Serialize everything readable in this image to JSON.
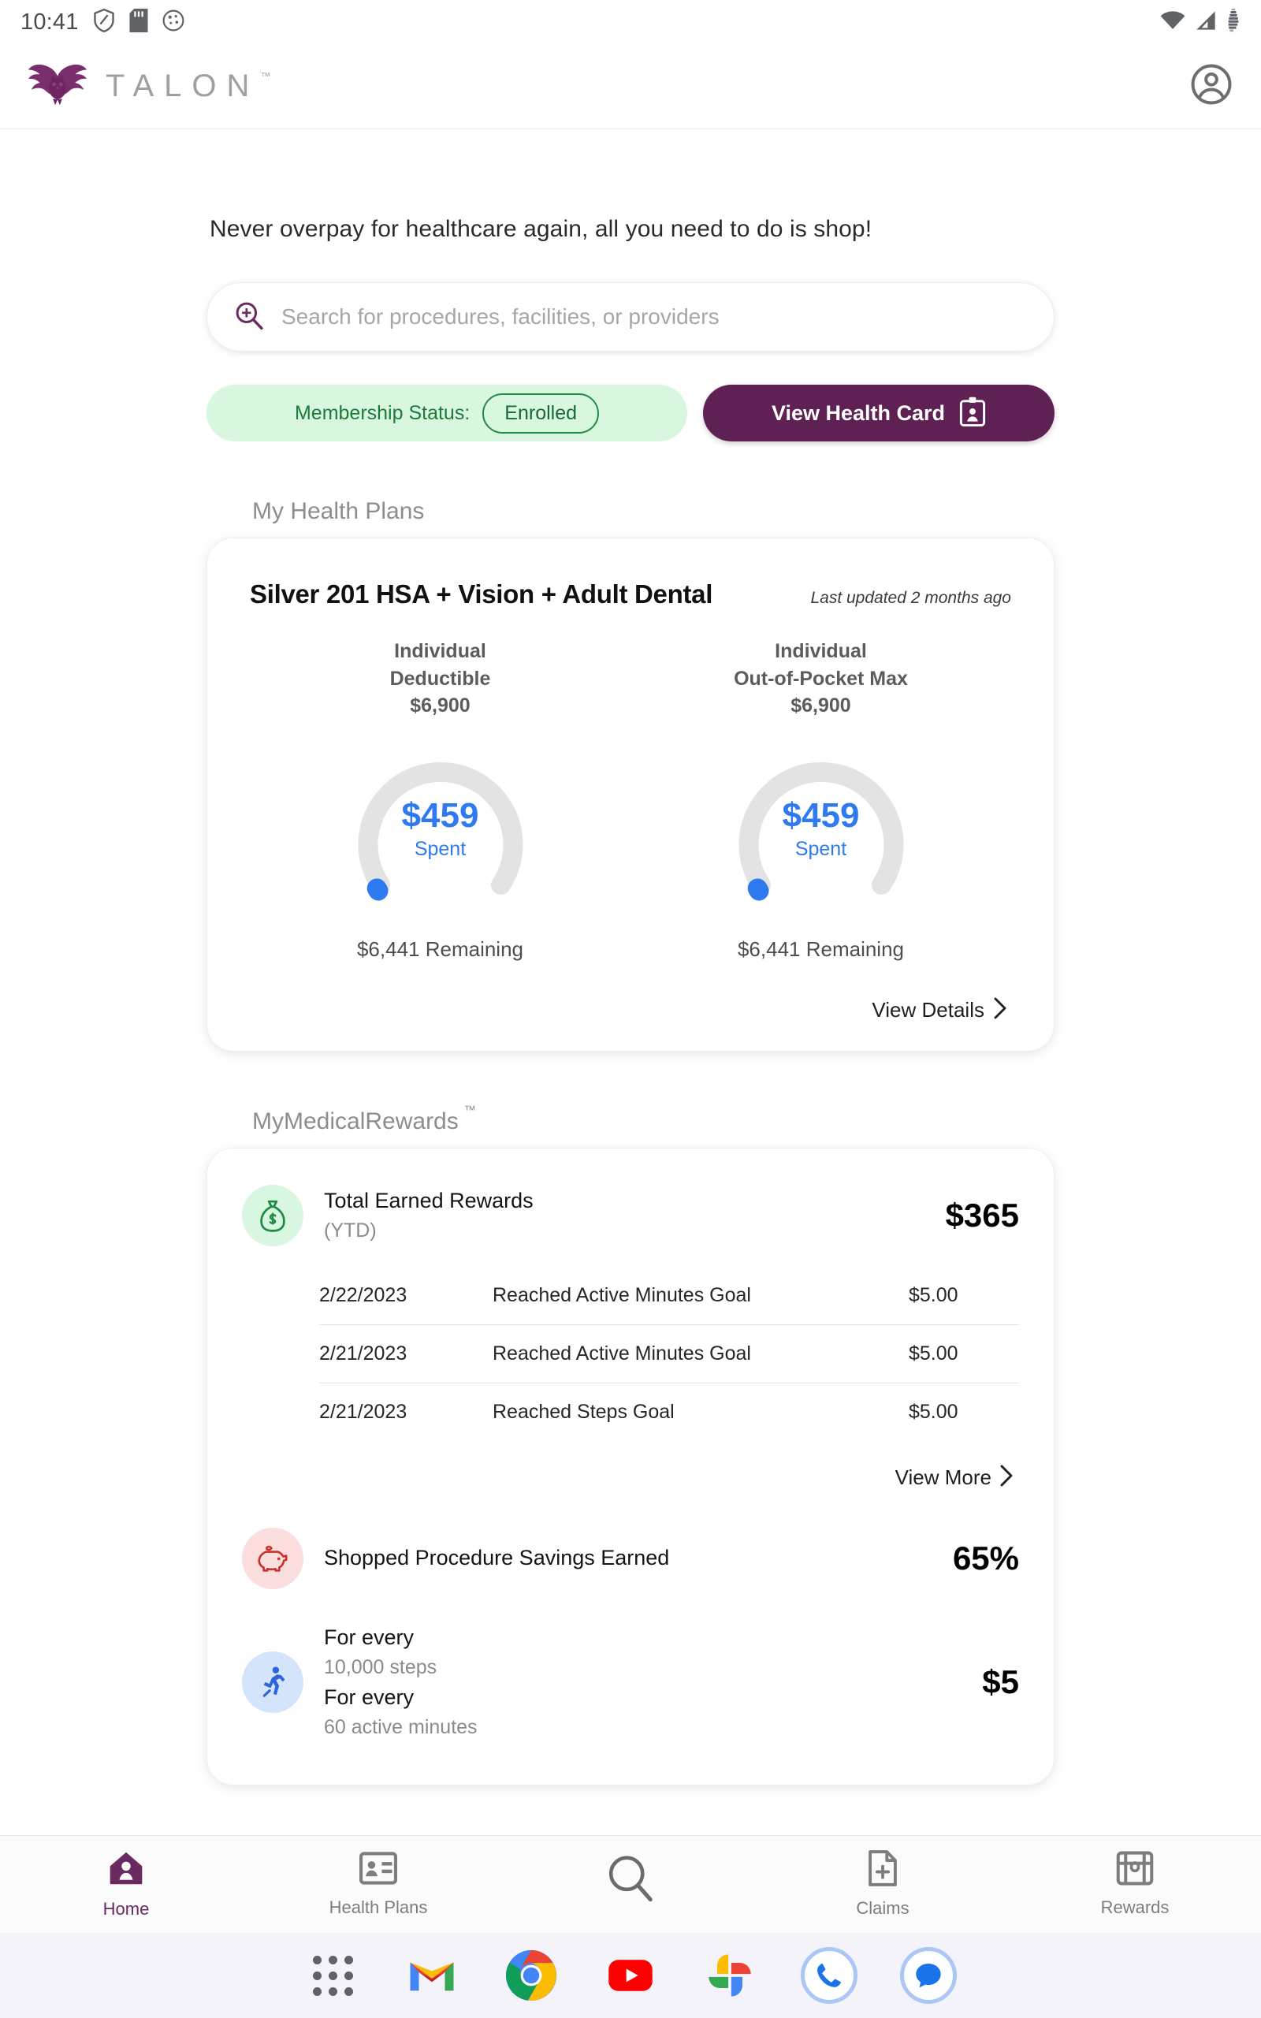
{
  "status_bar": {
    "time": "10:41",
    "left_icons": [
      "shield-icon",
      "sd-card-icon",
      "cookie-icon"
    ],
    "right_icons": [
      "wifi-icon",
      "cellular-signal-icon",
      "battery-bars-icon"
    ]
  },
  "app_header": {
    "brand": "TALON",
    "brand_tm": "™",
    "account_icon": "account-circle-icon"
  },
  "hero": {
    "tagline": "Never overpay for healthcare again, all you need to do is shop!"
  },
  "search": {
    "placeholder": "Search for procedures, facilities, or providers",
    "icon": "zoom-in-search-icon"
  },
  "membership": {
    "label": "Membership Status:",
    "status": "Enrolled",
    "health_card_button": "View Health Card",
    "health_card_icon": "id-badge-icon"
  },
  "health_plans": {
    "section_label": "My Health Plans",
    "plan_name": "Silver 201 HSA + Vision + Adult Dental",
    "last_updated": "Last updated 2 months ago",
    "view_details": "View Details",
    "gauges": [
      {
        "title_line1": "Individual",
        "title_line2": "Deductible",
        "limit": "$6,900",
        "spent_amount": "$459",
        "spent_label": "Spent",
        "remaining": "$6,441 Remaining",
        "percent": 6.7
      },
      {
        "title_line1": "Individual",
        "title_line2": "Out-of-Pocket Max",
        "limit": "$6,900",
        "spent_amount": "$459",
        "spent_label": "Spent",
        "remaining": "$6,441 Remaining",
        "percent": 6.7
      }
    ]
  },
  "rewards": {
    "section_label": "MyMedicalRewards",
    "section_tm": "™",
    "total": {
      "icon": "money-bag-icon",
      "title": "Total Earned Rewards",
      "subtitle": "(YTD)",
      "value": "$365"
    },
    "table_rows": [
      {
        "date": "2/22/2023",
        "description": "Reached Active Minutes Goal",
        "amount": "$5.00"
      },
      {
        "date": "2/21/2023",
        "description": "Reached Active Minutes Goal",
        "amount": "$5.00"
      },
      {
        "date": "2/21/2023",
        "description": "Reached Steps Goal",
        "amount": "$5.00"
      }
    ],
    "view_more": "View More",
    "savings": {
      "icon": "piggy-bank-icon",
      "title": "Shopped Procedure Savings Earned",
      "value": "65%"
    },
    "activity": {
      "icon": "running-person-icon",
      "title_1": "For every",
      "subtitle_1": "10,000 steps",
      "title_2": "For every",
      "subtitle_2": "60 active minutes",
      "value": "$5"
    }
  },
  "bottom_nav": [
    {
      "label": "Home",
      "icon": "home-person-icon",
      "active": true
    },
    {
      "label": "Health Plans",
      "icon": "id-card-icon",
      "active": false
    },
    {
      "label": "",
      "icon": "search-icon",
      "active": false
    },
    {
      "label": "Claims",
      "icon": "document-plus-icon",
      "active": false
    },
    {
      "label": "Rewards",
      "icon": "treasure-chest-icon",
      "active": false
    }
  ],
  "android_dock": [
    {
      "name": "app-drawer"
    },
    {
      "name": "gmail"
    },
    {
      "name": "chrome"
    },
    {
      "name": "youtube"
    },
    {
      "name": "google-photos"
    },
    {
      "name": "phone"
    },
    {
      "name": "messages"
    }
  ],
  "colors": {
    "brand_purple": "#5f2154",
    "accent_blue": "#2f7af0",
    "status_green": "#1f8a42",
    "gauge_track": "#e3e3e3"
  }
}
